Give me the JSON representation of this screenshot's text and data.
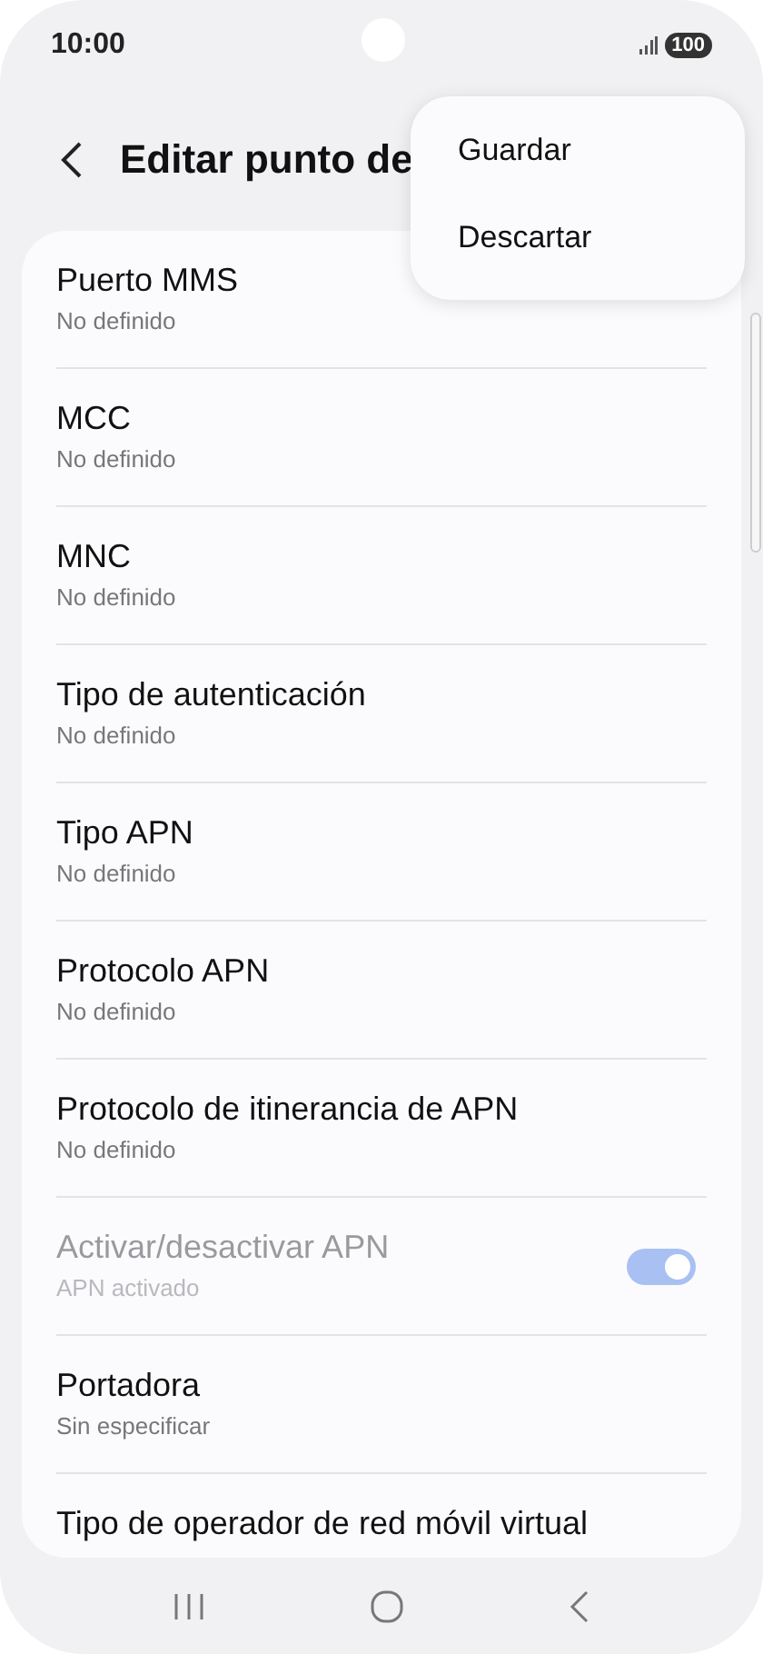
{
  "status_bar": {
    "time": "10:00",
    "battery": "100"
  },
  "header": {
    "title": "Editar punto de"
  },
  "menu": {
    "items": [
      {
        "label": "Guardar"
      },
      {
        "label": "Descartar"
      }
    ]
  },
  "settings": [
    {
      "kind": "text",
      "title": "Puerto MMS",
      "subtitle": "No definido",
      "disabled": false
    },
    {
      "kind": "text",
      "title": "MCC",
      "subtitle": "No definido",
      "disabled": false
    },
    {
      "kind": "text",
      "title": "MNC",
      "subtitle": "No definido",
      "disabled": false
    },
    {
      "kind": "text",
      "title": "Tipo de autenticación",
      "subtitle": "No definido",
      "disabled": false
    },
    {
      "kind": "text",
      "title": "Tipo APN",
      "subtitle": "No definido",
      "disabled": false
    },
    {
      "kind": "text",
      "title": "Protocolo APN",
      "subtitle": "No definido",
      "disabled": false
    },
    {
      "kind": "text",
      "title": "Protocolo de itinerancia de APN",
      "subtitle": "No definido",
      "disabled": false
    },
    {
      "kind": "toggle",
      "title": "Activar/desactivar APN",
      "subtitle": "APN activado",
      "disabled": true,
      "on": true
    },
    {
      "kind": "text",
      "title": "Portadora",
      "subtitle": "Sin especificar",
      "disabled": false
    },
    {
      "kind": "text",
      "title": "Tipo de operador de red móvil virtual",
      "disabled": false
    }
  ]
}
